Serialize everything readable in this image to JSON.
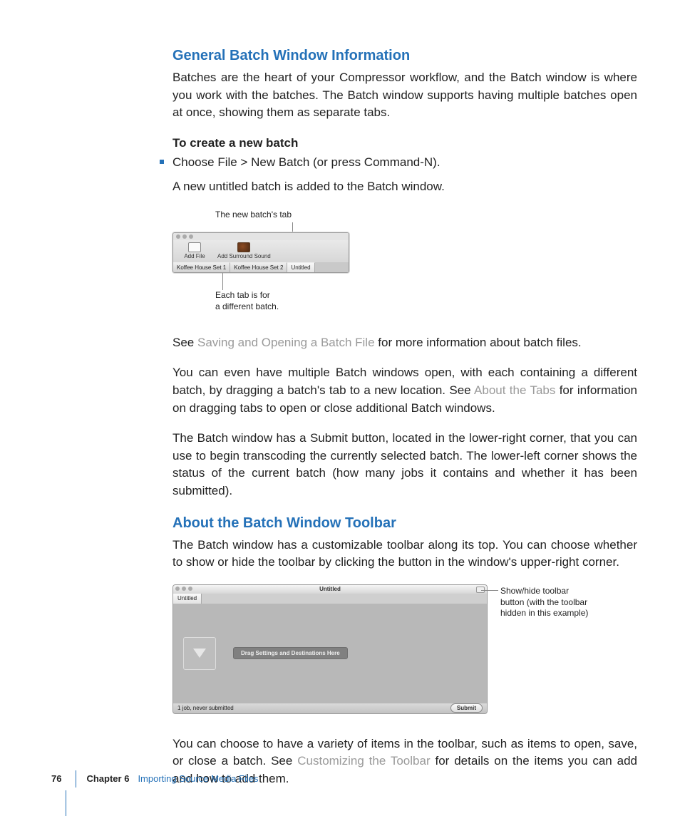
{
  "headings": {
    "general": "General Batch Window Information",
    "toolbar": "About the Batch Window Toolbar"
  },
  "para": {
    "general_intro": "Batches are the heart of your Compressor workflow, and the Batch window is where you work with the batches. The Batch window supports having multiple batches open at once, showing them as separate tabs.",
    "to_create_head": "To create a new batch",
    "bullet_choose": "Choose File > New Batch (or press Command-N).",
    "new_untitled": "A new untitled batch is added to the Batch window.",
    "see_pre": "See ",
    "see_link1": "Saving and Opening a Batch File",
    "see_post": " for more information about batch files.",
    "multi_pre": "You can even have multiple Batch windows open, with each containing a different batch, by dragging a batch's tab to a new location. See ",
    "multi_link": "About the Tabs",
    "multi_post": " for information on dragging tabs to open or close additional Batch windows.",
    "submit_para": "The Batch window has a Submit button, located in the lower-right corner, that you can use to begin transcoding the currently selected batch. The lower-left corner shows the status of the current batch (how many jobs it contains and whether it has been submitted).",
    "toolbar_intro": "The Batch window has a customizable toolbar along its top. You can choose whether to show or hide the toolbar by clicking the button in the window's upper-right corner.",
    "final_pre": "You can choose to have a variety of items in the toolbar, such as items to open, save, or close a batch. See ",
    "final_link": "Customizing the Toolbar",
    "final_post": " for details on the items you can add and how to add them."
  },
  "fig1": {
    "callout_top": "The new batch's tab",
    "toolbar_add_file": "Add File",
    "toolbar_surround": "Add Surround Sound",
    "tab1": "Koffee House Set 1",
    "tab2": "Koffee House Set 2",
    "tab3": "Untitled",
    "callout_bot_l1": "Each tab is for",
    "callout_bot_l2": "a different batch."
  },
  "fig2": {
    "win_title": "Untitled",
    "tab": "Untitled",
    "drag_text": "Drag Settings and Destinations Here",
    "status": "1 job, never submitted",
    "submit": "Submit",
    "callout_l1": "Show/hide toolbar",
    "callout_l2": "button (with the toolbar",
    "callout_l3": "hidden in this example)"
  },
  "footer": {
    "page": "76",
    "chapter": "Chapter 6",
    "title": "Importing Source Media Files"
  }
}
